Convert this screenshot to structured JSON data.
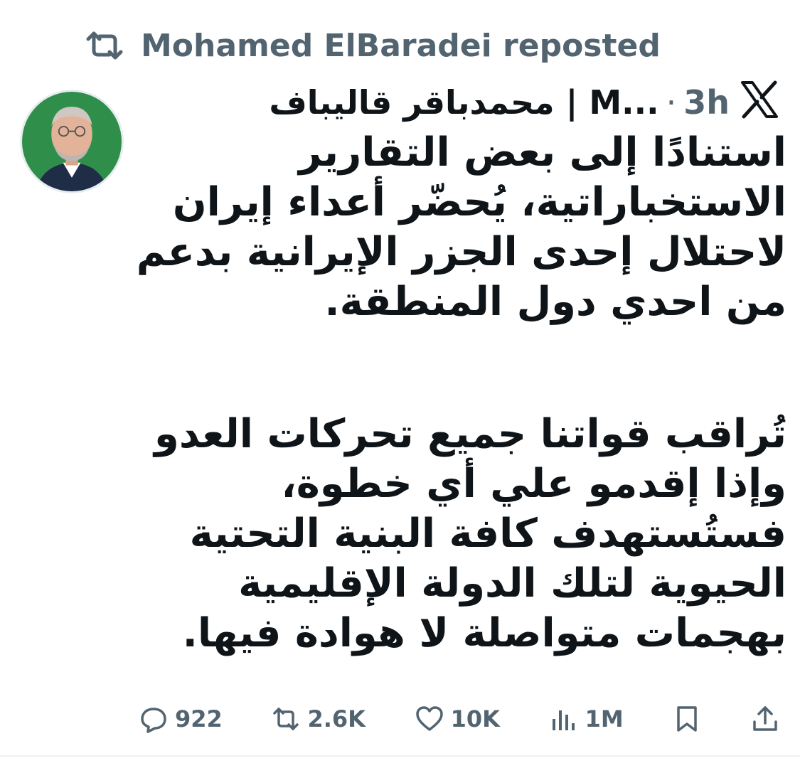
{
  "repost": {
    "icon": "repost-icon",
    "text": "Mohamed ElBaradei reposted"
  },
  "author": {
    "avatar": "avatar-icon",
    "display_name": "محمدباقر قاليباف | M...",
    "separator": "·",
    "time": "3h",
    "platform_icon": "x-logo-icon"
  },
  "tweet": {
    "paragraph1": [
      "استنادًا إلى بعض التقارير",
      "الاستخباراتية، يُحضّر أعداء إيران",
      "لاحتلال إحدى الجزر الإيرانية بدعم",
      "من احدي دول المنطقة."
    ],
    "paragraph2": [
      "تُراقب قواتنا جميع تحركات العدو",
      "وإذا إقدمو علي أي خطوة،",
      "فستُستهدف كافة البنية التحتية",
      "الحيوية لتلك الدولة الإقليمية",
      "بهجمات متواصلة لا هوادة فيها."
    ]
  },
  "actions": {
    "replies": "922",
    "reposts": "2.6K",
    "likes": "10K",
    "views": "1M",
    "icons": [
      "reply-icon",
      "repost-icon",
      "like-icon",
      "views-icon",
      "bookmark-icon",
      "share-icon"
    ]
  },
  "colors": {
    "text": "#0f1419",
    "muted": "#536471",
    "avatar_bg": "#2f8f4a"
  }
}
